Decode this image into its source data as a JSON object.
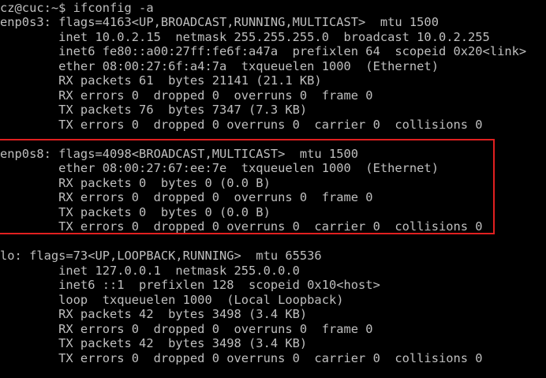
{
  "terminal": {
    "lines": [
      "cz@cuc:~$ ifconfig -a",
      "enp0s3: flags=4163<UP,BROADCAST,RUNNING,MULTICAST>  mtu 1500",
      "        inet 10.0.2.15  netmask 255.255.255.0  broadcast 10.0.2.255",
      "        inet6 fe80::a00:27ff:fe6f:a47a  prefixlen 64  scopeid 0x20<link>",
      "        ether 08:00:27:6f:a4:7a  txqueuelen 1000  (Ethernet)",
      "        RX packets 61  bytes 21141 (21.1 KB)",
      "        RX errors 0  dropped 0  overruns 0  frame 0",
      "        TX packets 76  bytes 7347 (7.3 KB)",
      "        TX errors 0  dropped 0 overruns 0  carrier 0  collisions 0",
      "",
      "enp0s8: flags=4098<BROADCAST,MULTICAST>  mtu 1500",
      "        ether 08:00:27:67:ee:7e  txqueuelen 1000  (Ethernet)",
      "        RX packets 0  bytes 0 (0.0 B)",
      "        RX errors 0  dropped 0  overruns 0  frame 0",
      "        TX packets 0  bytes 0 (0.0 B)",
      "        TX errors 0  dropped 0 overruns 0  carrier 0  collisions 0",
      "",
      "lo: flags=73<UP,LOOPBACK,RUNNING>  mtu 65536",
      "        inet 127.0.0.1  netmask 255.0.0.0",
      "        inet6 ::1  prefixlen 128  scopeid 0x10<host>",
      "        loop  txqueuelen 1000  (Local Loopback)",
      "        RX packets 42  bytes 3498 (3.4 KB)",
      "        RX errors 0  dropped 0  overruns 0  frame 0",
      "        TX packets 42  bytes 3498 (3.4 KB)",
      "        TX errors 0  dropped 0 overruns 0  carrier 0  collisions 0"
    ]
  },
  "colors": {
    "background": "#000000",
    "text": "#bfbfbf",
    "highlight_border": "#e02020"
  }
}
